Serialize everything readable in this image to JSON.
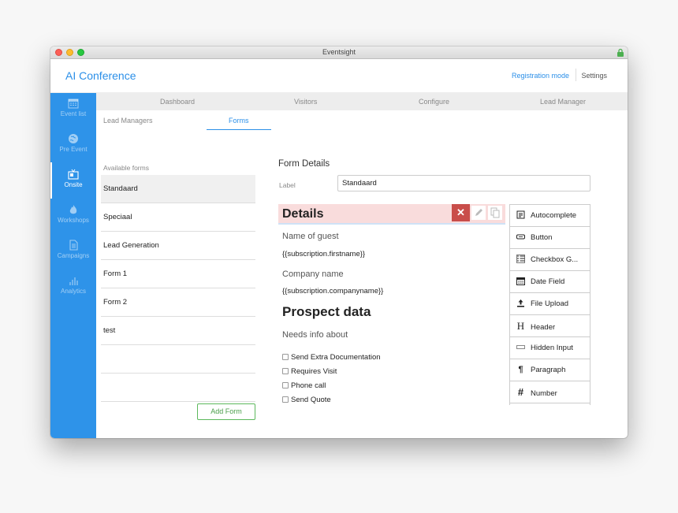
{
  "window": {
    "title": "Eventsight"
  },
  "app": {
    "title": "AI Conference",
    "registration_mode": "Registration mode",
    "settings": "Settings"
  },
  "sidebar": {
    "items": [
      {
        "label": "Event list",
        "icon": "calendar-icon"
      },
      {
        "label": "Pre Event",
        "icon": "globe-icon"
      },
      {
        "label": "Onsite",
        "icon": "onsite-icon",
        "active": true
      },
      {
        "label": "Workshops",
        "icon": "fire-icon"
      },
      {
        "label": "Campaigns",
        "icon": "document-icon"
      },
      {
        "label": "Analytics",
        "icon": "bar-chart-icon"
      }
    ]
  },
  "top_nav": {
    "tabs": [
      "Dashboard",
      "Visitors",
      "Configure",
      "Lead Manager"
    ]
  },
  "sub_tabs": {
    "tabs": [
      "Lead Managers",
      "Forms"
    ],
    "active": "Forms"
  },
  "available_forms": {
    "heading": "Available forms",
    "items": [
      "Standaard",
      "Speciaal",
      "Lead Generation",
      "Form 1",
      "Form 2",
      "test"
    ],
    "selected": "Standaard",
    "add_button": "Add Form"
  },
  "form_details": {
    "title": "Form Details",
    "label_caption": "Label",
    "label_value": "Standaard",
    "canvas": {
      "header": "Details",
      "fields": [
        {
          "label": "Name of guest",
          "value": "{{subscription.firstname}}"
        },
        {
          "label": "Company name",
          "value": "{{subscription.companyname}}"
        }
      ],
      "section": "Prospect data",
      "question": "Needs info about",
      "checkboxes": [
        "Send Extra Documentation",
        "Requires Visit",
        "Phone call",
        "Send Quote"
      ],
      "controls": {
        "delete": "✕"
      }
    }
  },
  "widgets": [
    {
      "label": "Autocomplete",
      "icon": "autocomplete-icon"
    },
    {
      "label": "Button",
      "icon": "button-icon"
    },
    {
      "label": "Checkbox G...",
      "icon": "checkbox-group-icon"
    },
    {
      "label": "Date Field",
      "icon": "calendar-icon"
    },
    {
      "label": "File Upload",
      "icon": "upload-icon"
    },
    {
      "label": "Header",
      "icon": "header-icon",
      "glyph": "H"
    },
    {
      "label": "Hidden Input",
      "icon": "hidden-input-icon"
    },
    {
      "label": "Paragraph",
      "icon": "paragraph-icon",
      "glyph": "¶"
    },
    {
      "label": "Number",
      "icon": "number-icon",
      "glyph": "#"
    }
  ],
  "colors": {
    "accent": "#2b8fe8",
    "sidebar": "#2e93e9",
    "delete": "#c94d4a",
    "add_button": "#5cb85c"
  }
}
